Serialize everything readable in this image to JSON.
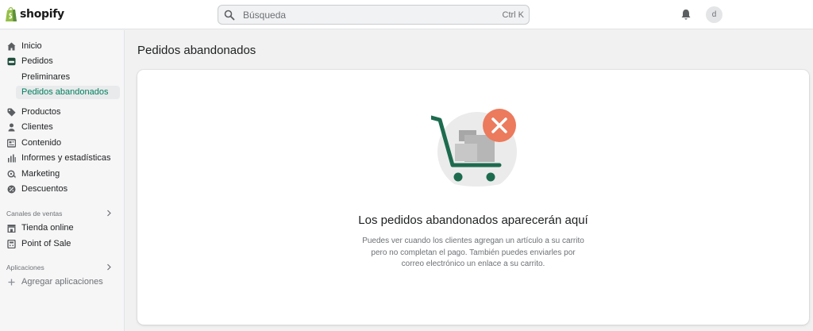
{
  "brand": {
    "name": "shopify",
    "bag_color": "#95bf47",
    "accent": "#008060"
  },
  "search": {
    "placeholder": "Búsqueda",
    "shortcut": "Ctrl K"
  },
  "user": {
    "initial": "d"
  },
  "sidebar": {
    "items": [
      {
        "label": "Inicio",
        "icon": "home-icon"
      },
      {
        "label": "Pedidos",
        "icon": "orders-icon"
      },
      {
        "label": "Productos",
        "icon": "tag-icon"
      },
      {
        "label": "Clientes",
        "icon": "person-icon"
      },
      {
        "label": "Contenido",
        "icon": "content-icon"
      },
      {
        "label": "Informes y estadísticas",
        "icon": "analytics-icon"
      },
      {
        "label": "Marketing",
        "icon": "marketing-icon"
      },
      {
        "label": "Descuentos",
        "icon": "discount-icon"
      }
    ],
    "orders_sub": [
      {
        "label": "Preliminares"
      },
      {
        "label": "Pedidos abandonados",
        "active": true
      }
    ],
    "sales_channels": {
      "heading": "Canales de ventas",
      "items": [
        {
          "label": "Tienda online",
          "icon": "store-icon"
        },
        {
          "label": "Point of Sale",
          "icon": "pos-icon"
        }
      ]
    },
    "apps": {
      "heading": "Aplicaciones",
      "add_label": "Agregar aplicaciones"
    }
  },
  "main": {
    "title": "Pedidos abandonados",
    "empty_state": {
      "title": "Los pedidos abandonados aparecerán aquí",
      "lines": [
        "Puedes ver cuando los clientes agregan un artículo a su carrito",
        "pero no completan el pago. También puedes enviarles por",
        "correo electrónico un enlace a su carrito."
      ],
      "illustration": "abandoned-cart-illustration"
    }
  }
}
